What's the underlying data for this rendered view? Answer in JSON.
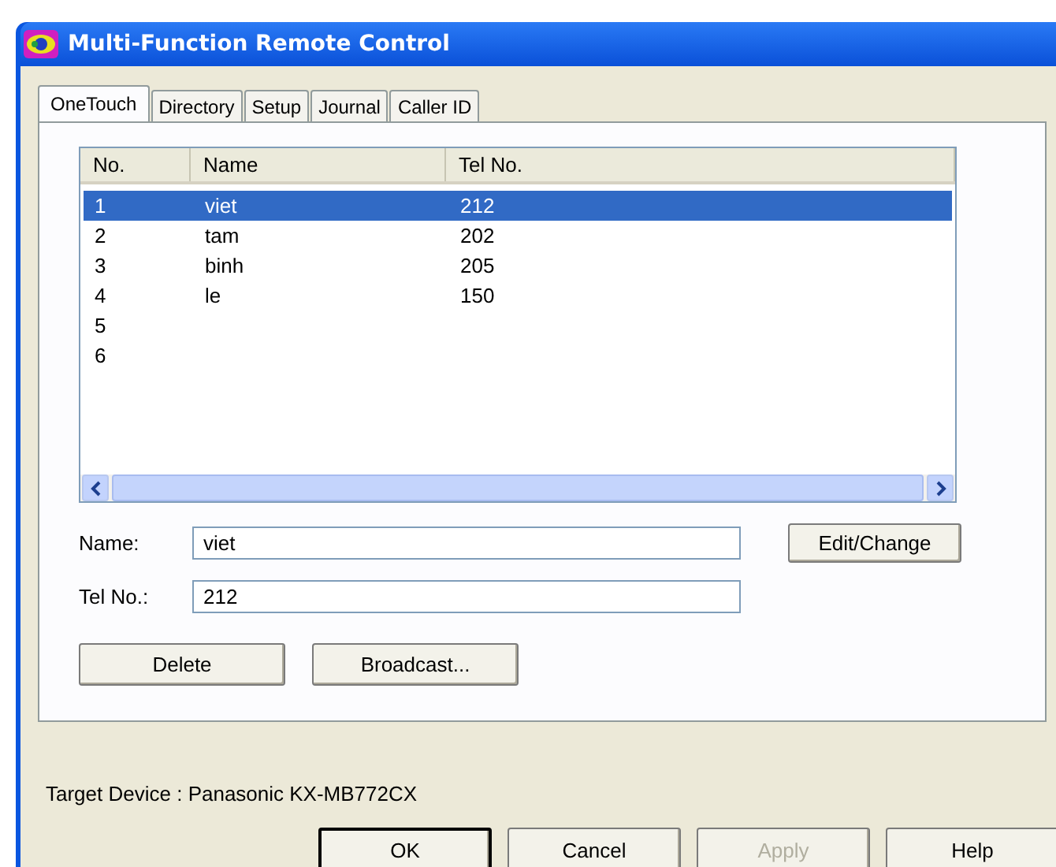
{
  "window": {
    "title": "Multi-Function Remote Control"
  },
  "tabs": [
    {
      "label": "OneTouch",
      "selected": true
    },
    {
      "label": "Directory",
      "selected": false
    },
    {
      "label": "Setup",
      "selected": false
    },
    {
      "label": "Journal",
      "selected": false
    },
    {
      "label": "Caller ID",
      "selected": false
    }
  ],
  "table": {
    "columns": [
      "No.",
      "Name",
      "Tel No."
    ],
    "rows": [
      {
        "cells": [
          "1",
          "viet",
          "212"
        ],
        "selected": true
      },
      {
        "cells": [
          "2",
          "tam",
          "202"
        ],
        "selected": false
      },
      {
        "cells": [
          "3",
          "binh",
          "205"
        ],
        "selected": false
      },
      {
        "cells": [
          "4",
          "le",
          "150"
        ],
        "selected": false
      },
      {
        "cells": [
          "5"
        ],
        "selected": false
      },
      {
        "cells": [
          "6"
        ],
        "selected": false
      }
    ]
  },
  "fields": [
    {
      "label": "Name:",
      "value": "viet"
    },
    {
      "label": "Tel No.:",
      "value": "212"
    }
  ],
  "edit_button": "Edit/Change",
  "panel_buttons": [
    "Delete",
    "Broadcast..."
  ],
  "target_device": "Target Device : Panasonic KX-MB772CX",
  "dialog_buttons": [
    {
      "label": "OK",
      "disabled": false,
      "default": true
    },
    {
      "label": "Cancel",
      "disabled": false,
      "default": false
    },
    {
      "label": "Apply",
      "disabled": true,
      "default": false
    },
    {
      "label": "Help",
      "disabled": false,
      "default": false
    }
  ]
}
